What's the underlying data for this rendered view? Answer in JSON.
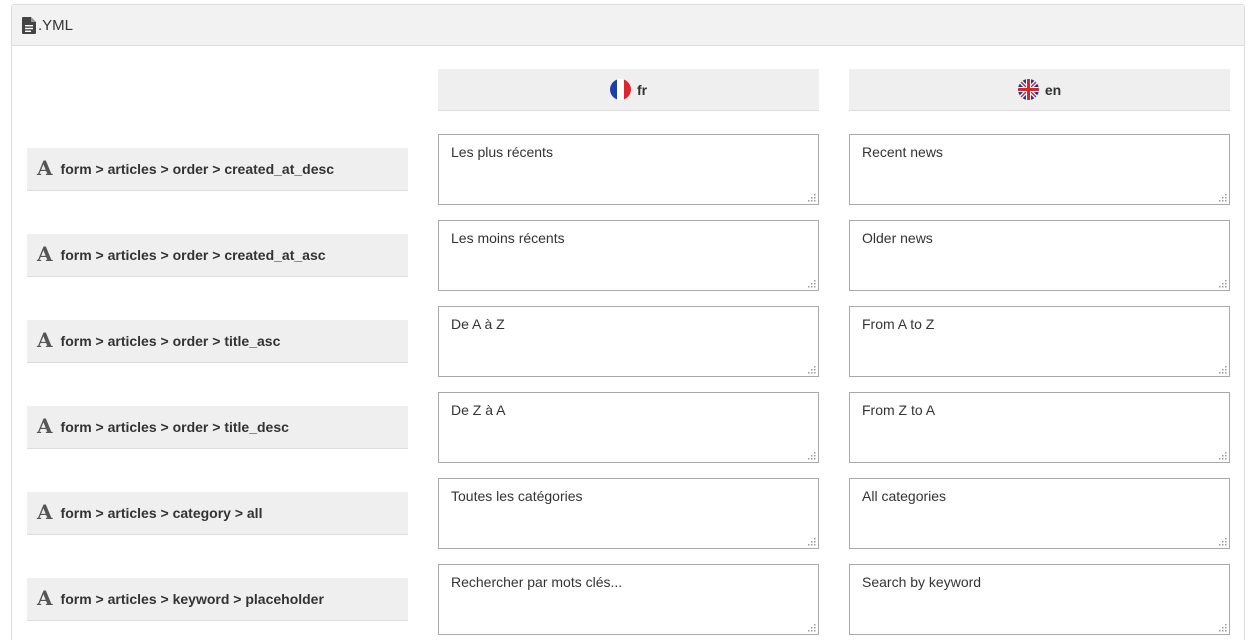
{
  "panel": {
    "title": ".YML",
    "icon": "file-text-icon"
  },
  "languages": [
    {
      "code": "fr",
      "flag": "france-flag-icon"
    },
    {
      "code": "en",
      "flag": "uk-flag-icon"
    }
  ],
  "rows": [
    {
      "key": "form > articles > order > created_at_desc",
      "fr": "Les plus récents",
      "en": "Recent news"
    },
    {
      "key": "form > articles > order > created_at_asc",
      "fr": "Les moins récents",
      "en": "Older news"
    },
    {
      "key": "form > articles > order > title_asc",
      "fr": "De A à Z",
      "en": "From A to Z"
    },
    {
      "key": "form > articles > order > title_desc",
      "fr": "De Z à A",
      "en": "From Z to A"
    },
    {
      "key": "form > articles > category > all",
      "fr": "Toutes les catégories",
      "en": "All categories"
    },
    {
      "key": "form > articles > keyword > placeholder",
      "fr": "Rechercher par mots clés...",
      "en": "Search by keyword"
    }
  ],
  "icons": {
    "key_type": "text-font-icon",
    "resize": "resize-grip-icon"
  },
  "colors": {
    "header_bg": "#efefef",
    "border": "#a9a9a9",
    "text": "#333333"
  }
}
